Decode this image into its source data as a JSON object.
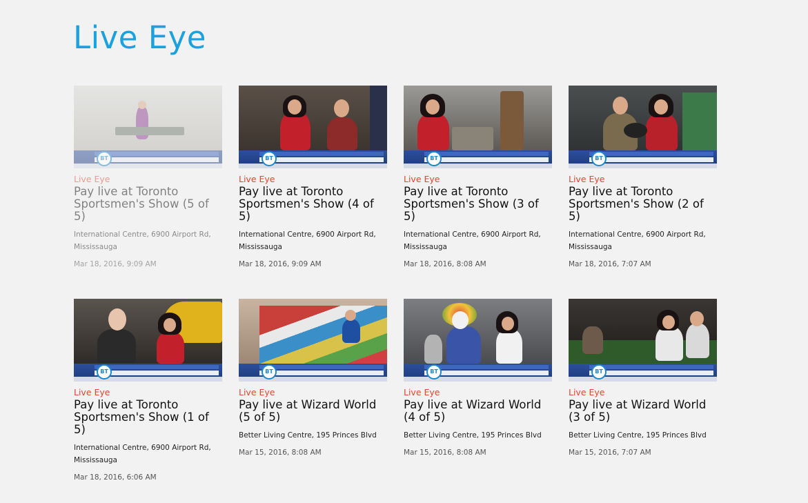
{
  "page": {
    "title": "Live Eye"
  },
  "thumbnail": {
    "logo_text": "BT"
  },
  "cards": [
    {
      "category": "Live Eye",
      "title": "Pay live at Toronto Sportsmen's Show (5 of 5)",
      "location": "International Centre, 6900 Airport Rd, Mississauga",
      "date": "Mar 18, 2016, 9:09 AM"
    },
    {
      "category": "Live Eye",
      "title": "Pay live at Toronto Sportsmen's Show (4 of 5)",
      "location": "International Centre, 6900 Airport Rd, Mississauga",
      "date": "Mar 18, 2016, 9:09 AM"
    },
    {
      "category": "Live Eye",
      "title": "Pay live at Toronto Sportsmen's Show (3 of 5)",
      "location": "International Centre, 6900 Airport Rd, Mississauga",
      "date": "Mar 18, 2016, 8:08 AM"
    },
    {
      "category": "Live Eye",
      "title": "Pay live at Toronto Sportsmen's Show (2 of 5)",
      "location": "International Centre, 6900 Airport Rd, Mississauga",
      "date": "Mar 18, 2016, 7:07 AM"
    },
    {
      "category": "Live Eye",
      "title": "Pay live at Toronto Sportsmen's Show (1 of 5)",
      "location": "International Centre, 6900 Airport Rd, Mississauga",
      "date": "Mar 18, 2016, 6:06 AM"
    },
    {
      "category": "Live Eye",
      "title": "Pay live at Wizard World (5 of 5)",
      "location": "Better Living Centre, 195 Princes Blvd",
      "date": "Mar 15, 2016, 8:08 AM"
    },
    {
      "category": "Live Eye",
      "title": "Pay live at Wizard World (4 of 5)",
      "location": "Better Living Centre, 195 Princes Blvd",
      "date": "Mar 15, 2016, 8:08 AM"
    },
    {
      "category": "Live Eye",
      "title": "Pay live at Wizard World (3 of 5)",
      "location": "Better Living Centre, 195 Princes Blvd",
      "date": "Mar 15, 2016, 7:07 AM"
    }
  ]
}
